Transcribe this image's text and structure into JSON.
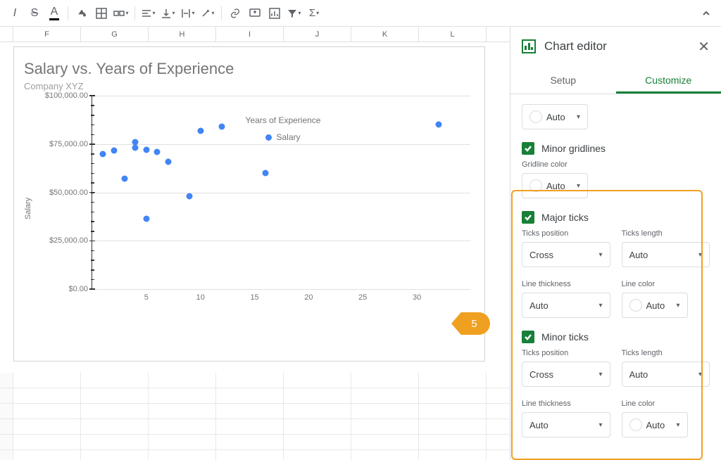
{
  "columns": [
    "F",
    "G",
    "H",
    "I",
    "J",
    "K",
    "L"
  ],
  "sidebar": {
    "title": "Chart editor",
    "tabs": {
      "setup": "Setup",
      "customize": "Customize"
    },
    "auto_label": "Auto",
    "minor_gridlines_label": "Minor gridlines",
    "gridline_color_label": "Gridline color",
    "major_ticks_label": "Major ticks",
    "minor_ticks_label": "Minor ticks",
    "ticks_position_label": "Ticks position",
    "ticks_length_label": "Ticks length",
    "line_thickness_label": "Line thickness",
    "line_color_label": "Line color",
    "cross_value": "Cross"
  },
  "callout": {
    "number": "5"
  },
  "chart_data": {
    "type": "scatter",
    "title": "Salary vs. Years of Experience",
    "subtitle": "Company XYZ",
    "xlabel": "Years of Experience",
    "ylabel": "Salary",
    "legend": "Salary",
    "xlim": [
      0,
      35
    ],
    "ylim": [
      0,
      100000
    ],
    "xticks": [
      5,
      10,
      15,
      20,
      25,
      30
    ],
    "yticks_labels": [
      "$0.00",
      "$25,000.00",
      "$50,000.00",
      "$75,000.00",
      "$100,000.00"
    ],
    "yticks_values": [
      0,
      25000,
      50000,
      75000,
      100000
    ],
    "points": [
      {
        "x": 1,
        "y": 70000
      },
      {
        "x": 2,
        "y": 71500
      },
      {
        "x": 3,
        "y": 57000
      },
      {
        "x": 4,
        "y": 73000
      },
      {
        "x": 4,
        "y": 76000
      },
      {
        "x": 5,
        "y": 36500
      },
      {
        "x": 5,
        "y": 72000
      },
      {
        "x": 6,
        "y": 71000
      },
      {
        "x": 7,
        "y": 66000
      },
      {
        "x": 9,
        "y": 48000
      },
      {
        "x": 10,
        "y": 82000
      },
      {
        "x": 12,
        "y": 84000
      },
      {
        "x": 16,
        "y": 60000
      },
      {
        "x": 32,
        "y": 85000
      }
    ]
  }
}
